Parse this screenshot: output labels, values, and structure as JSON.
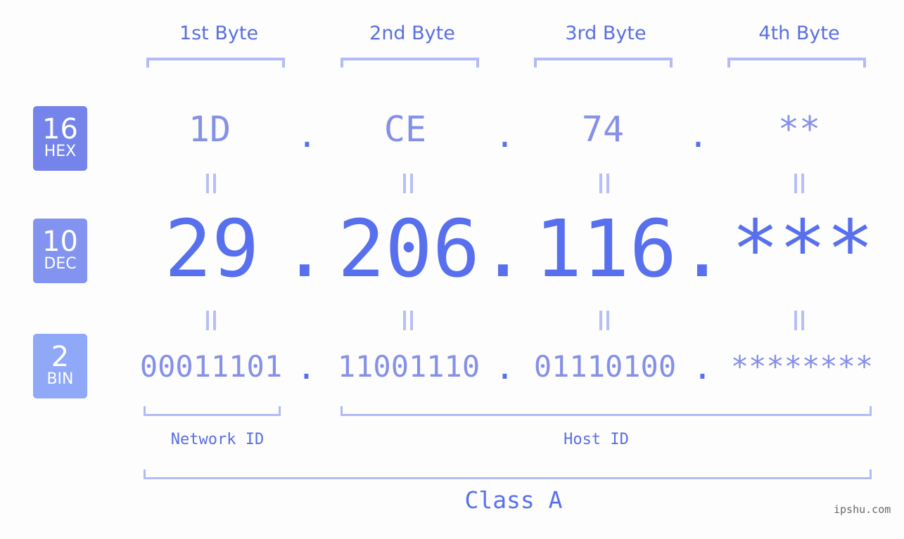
{
  "bytes_header": [
    "1st Byte",
    "2nd Byte",
    "3rd Byte",
    "4th Byte"
  ],
  "bases": [
    {
      "number": "16",
      "label": "HEX",
      "color": "#7484ea"
    },
    {
      "number": "10",
      "label": "DEC",
      "color": "#8394f0"
    },
    {
      "number": "2",
      "label": "BIN",
      "color": "#8fa8f8"
    }
  ],
  "hex": [
    "1D",
    "CE",
    "74",
    "**"
  ],
  "dec": [
    "29",
    "206",
    "116",
    "***"
  ],
  "bin": [
    "00011101",
    "11001110",
    "01110100",
    "********"
  ],
  "separator": ".",
  "network_label": "Network ID",
  "host_label": "Host ID",
  "class_label": "Class A",
  "watermark": "ipshu.com"
}
